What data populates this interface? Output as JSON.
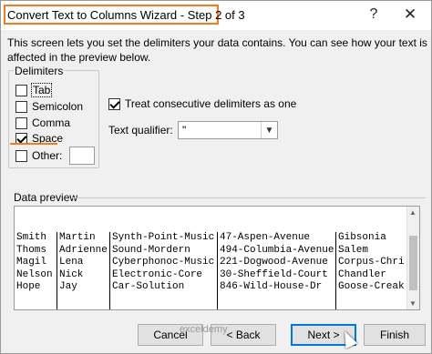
{
  "window": {
    "title": "Convert Text to Columns Wizard - Step 2 of 3",
    "help_glyph": "?",
    "close_glyph": "✕",
    "highlight_color": "#f47b20"
  },
  "intro": "This screen lets you set the delimiters your data contains.  You can see how your text is affected in the preview below.",
  "delimiters": {
    "group_label": "Delimiters",
    "items": [
      {
        "label": "Tab",
        "checked": false
      },
      {
        "label": "Semicolon",
        "checked": false
      },
      {
        "label": "Comma",
        "checked": false
      },
      {
        "label": "Space",
        "checked": true
      },
      {
        "label": "Other:",
        "checked": false
      }
    ],
    "other_value": ""
  },
  "options": {
    "consecutive_label": "Treat consecutive delimiters as one",
    "consecutive_checked": true,
    "qualifier_label": "Text qualifier:",
    "qualifier_value": "\""
  },
  "preview": {
    "label": "Data preview",
    "columns": [
      [
        "Smith",
        "Thoms",
        "Magil",
        "Nelson",
        "Hope"
      ],
      [
        "Martin",
        "Adrienne",
        "Lena",
        "Nick",
        "Jay"
      ],
      [
        "Synth-Point-Music",
        "Sound-Mordern",
        "Cyberphonoc-Music",
        "Electronic-Core",
        "Car-Solution"
      ],
      [
        "47-Aspen-Avenue",
        "494-Columbia-Avenue",
        "221-Dogwood-Avenue",
        "30-Sheffield-Court",
        "846-Wild-House-Dr"
      ],
      [
        "Gibsonia",
        "Salem",
        "Corpus-Chri",
        "Chandler",
        "Goose-Creak"
      ]
    ]
  },
  "buttons": {
    "cancel": "Cancel",
    "back": "< Back",
    "next": "Next >",
    "finish": "Finish"
  },
  "watermark": "exceldemy"
}
